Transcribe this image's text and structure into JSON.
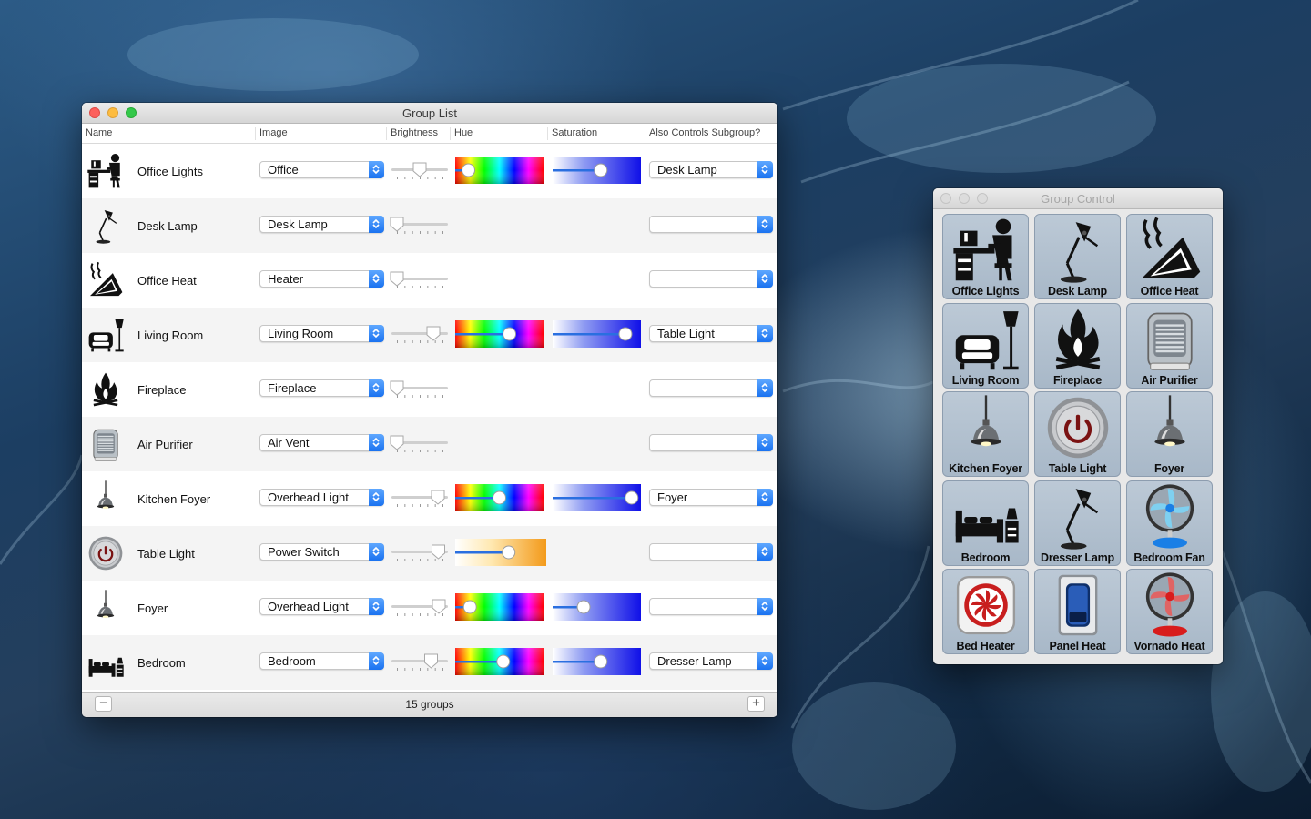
{
  "group_list": {
    "title": "Group List",
    "columns": [
      "Name",
      "Image",
      "Brightness",
      "Hue",
      "Saturation",
      "Also Controls Subgroup?"
    ],
    "rows": [
      {
        "name": "Office Lights",
        "image": "Office",
        "icon": "office-desk-icon",
        "brightness": 0.5,
        "hue": 0.1,
        "saturation": 0.55,
        "subgroup": "Desk Lamp",
        "color_controls": "full"
      },
      {
        "name": "Desk Lamp",
        "image": "Desk Lamp",
        "icon": "desk-lamp-icon",
        "brightness": 0.0,
        "subgroup": "",
        "color_controls": "none"
      },
      {
        "name": "Office Heat",
        "image": "Heater",
        "icon": "heater-icon",
        "brightness": 0.0,
        "subgroup": "",
        "color_controls": "none"
      },
      {
        "name": "Living Room",
        "image": "Living Room",
        "icon": "armchair-lamp-icon",
        "brightness": 0.8,
        "hue": 0.63,
        "saturation": 0.87,
        "subgroup": "Table Light",
        "color_controls": "full"
      },
      {
        "name": "Fireplace",
        "image": "Fireplace",
        "icon": "fireplace-icon",
        "brightness": 0.0,
        "subgroup": "",
        "color_controls": "none"
      },
      {
        "name": "Air Purifier",
        "image": "Air Vent",
        "icon": "air-purifier-icon",
        "brightness": 0.0,
        "subgroup": "",
        "color_controls": "none"
      },
      {
        "name": "Kitchen Foyer",
        "image": "Overhead Light",
        "icon": "pendant-light-icon",
        "brightness": 0.9,
        "hue": 0.5,
        "saturation": 0.95,
        "subgroup": "Foyer",
        "color_controls": "full"
      },
      {
        "name": "Table Light",
        "image": "Power Switch",
        "icon": "power-switch-icon",
        "brightness": 0.91,
        "hue": 0.62,
        "subgroup": "",
        "color_controls": "temperature"
      },
      {
        "name": "Foyer",
        "image": "Overhead Light",
        "icon": "pendant-light-icon",
        "brightness": 0.92,
        "hue": 0.12,
        "saturation": 0.33,
        "subgroup": "",
        "color_controls": "full"
      },
      {
        "name": "Bedroom",
        "image": "Bedroom",
        "icon": "bed-icon",
        "brightness": 0.75,
        "hue": 0.55,
        "saturation": 0.55,
        "subgroup": "Dresser Lamp",
        "color_controls": "full"
      }
    ],
    "footer": {
      "count_text": "15 groups",
      "remove_label": "−",
      "add_label": "+"
    }
  },
  "group_control": {
    "title": "Group Control",
    "tiles": [
      {
        "label": "Office Lights",
        "icon": "office-desk-icon"
      },
      {
        "label": "Desk Lamp",
        "icon": "desk-lamp-icon"
      },
      {
        "label": "Office Heat",
        "icon": "heater-icon"
      },
      {
        "label": "Living Room",
        "icon": "armchair-lamp-icon"
      },
      {
        "label": "Fireplace",
        "icon": "fireplace-icon"
      },
      {
        "label": "Air Purifier",
        "icon": "air-purifier-icon"
      },
      {
        "label": "Kitchen Foyer",
        "icon": "pendant-light-icon"
      },
      {
        "label": "Table Light",
        "icon": "power-switch-icon"
      },
      {
        "label": "Foyer",
        "icon": "pendant-light-icon"
      },
      {
        "label": "Bedroom",
        "icon": "bed-icon"
      },
      {
        "label": "Dresser Lamp",
        "icon": "desk-lamp-icon"
      },
      {
        "label": "Bedroom Fan",
        "icon": "blue-fan-icon"
      },
      {
        "label": "Bed Heater",
        "icon": "red-fan-heater-icon"
      },
      {
        "label": "Panel Heat",
        "icon": "panel-heater-icon"
      },
      {
        "label": "Vornado Heat",
        "icon": "red-fan-icon"
      }
    ]
  },
  "colors": {
    "accent": "#1a72f0",
    "tile_bg": "#b4c3d2",
    "desktop": "#1c3e62"
  }
}
